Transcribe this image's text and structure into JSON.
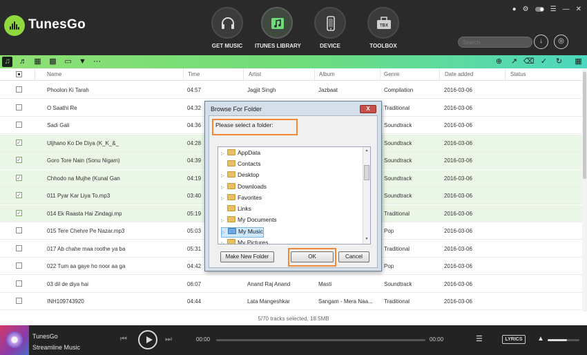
{
  "app": {
    "name": "TunesGo"
  },
  "nav": [
    {
      "label": "GET MUSIC",
      "icon": "headphones-icon"
    },
    {
      "label": "ITUNES LIBRARY",
      "icon": "itunes-library-icon"
    },
    {
      "label": "DEVICE",
      "icon": "phone-icon"
    },
    {
      "label": "TOOLBOX",
      "icon": "toolbox-icon"
    }
  ],
  "toolbox_badge": "TBX",
  "search": {
    "placeholder": "Search"
  },
  "table": {
    "columns": [
      "Name",
      "Time",
      "Artist",
      "Album",
      "Genre",
      "Date added",
      "Status"
    ],
    "rows": [
      {
        "name": "Phoolon Ki Tarah",
        "time": "04:57",
        "artist": "Jagjit Singh",
        "album": "Jazbaat",
        "genre": "Compilation",
        "date": "2016-03-06",
        "checked": false
      },
      {
        "name": "O Saathi  Re",
        "time": "04:32",
        "artist": "",
        "album": "",
        "genre": "Traditional",
        "date": "2016-03-06",
        "checked": false
      },
      {
        "name": "Sadi Gali",
        "time": "04:36",
        "artist": "",
        "album": "",
        "genre": "Soundtrack",
        "date": "2016-03-06",
        "checked": false
      },
      {
        "name": "Uljhano Ko De Diya (K_K_&_",
        "time": "04:28",
        "artist": "",
        "album": "",
        "genre": "Soundtrack",
        "date": "2016-03-06",
        "checked": true
      },
      {
        "name": "Goro Tore Nain (Sonu Nigam)",
        "time": "04:39",
        "artist": "",
        "album": "",
        "genre": "Soundtrack",
        "date": "2016-03-06",
        "checked": true
      },
      {
        "name": "Chhodo na Mujhe (Kunal Gan",
        "time": "04:19",
        "artist": "",
        "album": "",
        "genre": "Soundtrack",
        "date": "2016-03-06",
        "checked": true
      },
      {
        "name": "011 Pyar Kar Liya To.mp3",
        "time": "03:40",
        "artist": "",
        "album": "",
        "genre": "Soundtrack",
        "date": "2016-03-06",
        "checked": true
      },
      {
        "name": "014  Ek Raasta Hai Zindagi.mp",
        "time": "05:19",
        "artist": "",
        "album": "",
        "genre": "Traditional",
        "date": "2016-03-06",
        "checked": true
      },
      {
        "name": "015  Tere Chehre Pe Nazar.mp3",
        "time": "05:03",
        "artist": "",
        "album": "",
        "genre": "Pop",
        "date": "2016-03-06",
        "checked": false
      },
      {
        "name": "017 Ab chahe maa roothe ya ba",
        "time": "05:31",
        "artist": "",
        "album": "",
        "genre": "Traditional",
        "date": "2016-03-06",
        "checked": false
      },
      {
        "name": "022 Tum aa gaye ho noor aa ga",
        "time": "04:42",
        "artist": "",
        "album": "",
        "genre": "Pop",
        "date": "2016-03-06",
        "checked": false
      },
      {
        "name": "03 dil de diya hai",
        "time": "06:07",
        "artist": "Anand Raj Anand",
        "album": "Masti",
        "genre": "Soundtrack",
        "date": "2016-03-06",
        "checked": false
      },
      {
        "name": "INH109743920",
        "time": "04:44",
        "artist": "Lata Mangeshkar",
        "album": "Sangam - Mera Naa...",
        "genre": "Traditional",
        "date": "2016-03-06",
        "checked": false
      }
    ]
  },
  "status": "5/70 tracks selected, 18.5MB",
  "player": {
    "title": "TunesGo",
    "artist": "Streamline Music",
    "time_current": "00:00",
    "time_total": "00:00",
    "lyrics_label": "LYRICS",
    "volume_level": 0.6
  },
  "dialog": {
    "title": "Browse For Folder",
    "close_label": "X",
    "prompt": "Please select a folder:",
    "tree": [
      {
        "label": "AppData",
        "expandable": true,
        "selected": false
      },
      {
        "label": "Contacts",
        "expandable": false,
        "selected": false
      },
      {
        "label": "Desktop",
        "expandable": true,
        "selected": false
      },
      {
        "label": "Downloads",
        "expandable": true,
        "selected": false
      },
      {
        "label": "Favorites",
        "expandable": true,
        "selected": false
      },
      {
        "label": "Links",
        "expandable": false,
        "selected": false
      },
      {
        "label": "My Documents",
        "expandable": true,
        "selected": false
      },
      {
        "label": "My Music",
        "expandable": true,
        "selected": true
      },
      {
        "label": "My Pictures",
        "expandable": true,
        "selected": false
      }
    ],
    "make_folder_label": "Make New Folder",
    "ok_label": "OK",
    "cancel_label": "Cancel"
  }
}
